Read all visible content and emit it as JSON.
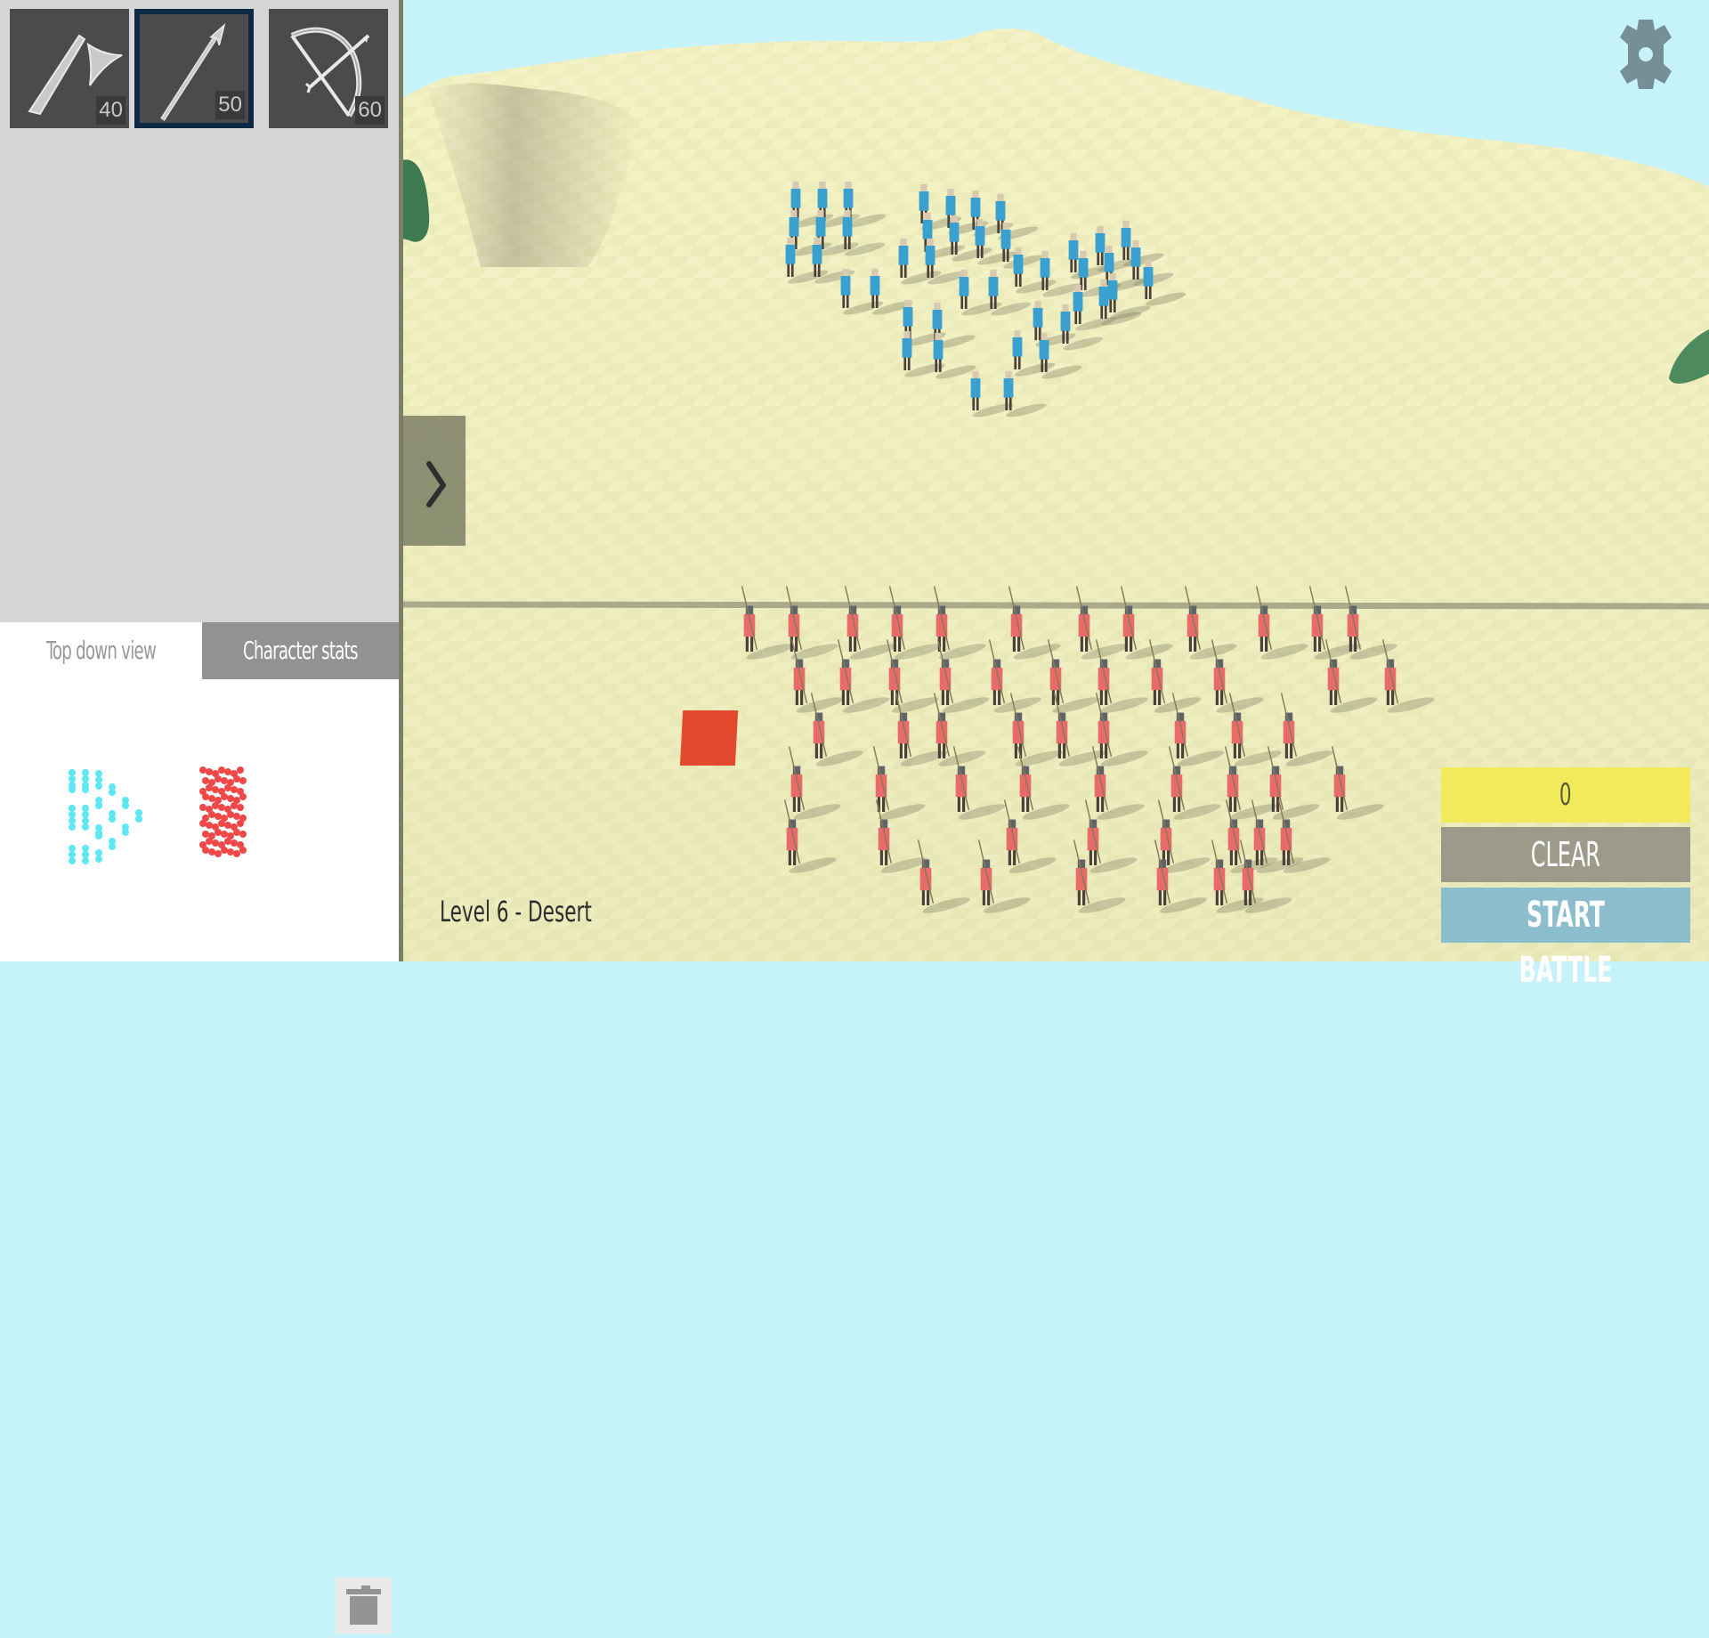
{
  "level": {
    "label": "Level 6 - Desert"
  },
  "units": [
    {
      "name": "Axe",
      "icon": "axe-icon",
      "cost": "40",
      "selected": false
    },
    {
      "name": "Spear",
      "icon": "spear-icon",
      "cost": "50",
      "selected": true
    },
    {
      "name": "Bow",
      "icon": "bow-icon",
      "cost": "60",
      "selected": false
    }
  ],
  "tabs": {
    "top_down": "Top down view",
    "stats": "Character stats",
    "active": "top_down"
  },
  "actions": {
    "count": "0",
    "clear": "CLEAR",
    "start": "START BATTLE"
  },
  "colors": {
    "sky": "#c6f3fa",
    "sand": "#f3f2c2",
    "team_blue": "#3aa0cf",
    "team_red": "#e86a6a",
    "selected_border": "#0c2a45",
    "count_button": "#f2e95b",
    "clear_button": "#9c9b8b",
    "start_button": "#8cbdcc",
    "gear": "#768e95",
    "minimap_blue": "#5de8f3",
    "minimap_red": "#f04848",
    "placement_marker": "#e2492d"
  },
  "icons": {
    "drawer_toggle": "chevron-right-icon",
    "settings": "gear-icon",
    "delete": "trash-icon"
  }
}
